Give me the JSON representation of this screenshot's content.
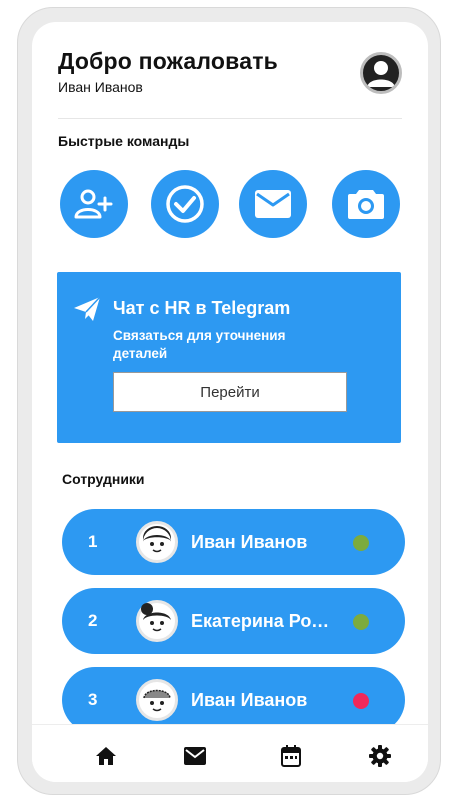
{
  "header": {
    "title": "Добро пожаловать",
    "user_name": "Иван Иванов",
    "avatar_icon": "account-circle-icon"
  },
  "quick_actions": {
    "label": "Быстрые команды",
    "items": [
      {
        "icon": "add-user-icon"
      },
      {
        "icon": "check-circle-icon"
      },
      {
        "icon": "mail-icon"
      },
      {
        "icon": "camera-icon"
      }
    ]
  },
  "telegram_card": {
    "icon": "send-icon",
    "title": "Чат с HR в Telegram",
    "description": "Связаться для уточнения деталей",
    "button_label": "Перейти"
  },
  "employees": {
    "label": "Сотрудники",
    "items": [
      {
        "number": "1",
        "name": "Иван Иванов",
        "status_color": "#7cab3e"
      },
      {
        "number": "2",
        "name": "Екатерина Ромашкина",
        "status_color": "#7cab3e"
      },
      {
        "number": "3",
        "name": "Иван Иванов",
        "status_color": "#f0285a"
      }
    ]
  },
  "bottom_nav": {
    "items": [
      {
        "icon": "home-icon"
      },
      {
        "icon": "mail-icon"
      },
      {
        "icon": "calendar-icon"
      },
      {
        "icon": "settings-icon"
      }
    ]
  },
  "colors": {
    "accent": "#2d99f2",
    "status_online": "#7cab3e",
    "status_offline": "#f0285a"
  }
}
